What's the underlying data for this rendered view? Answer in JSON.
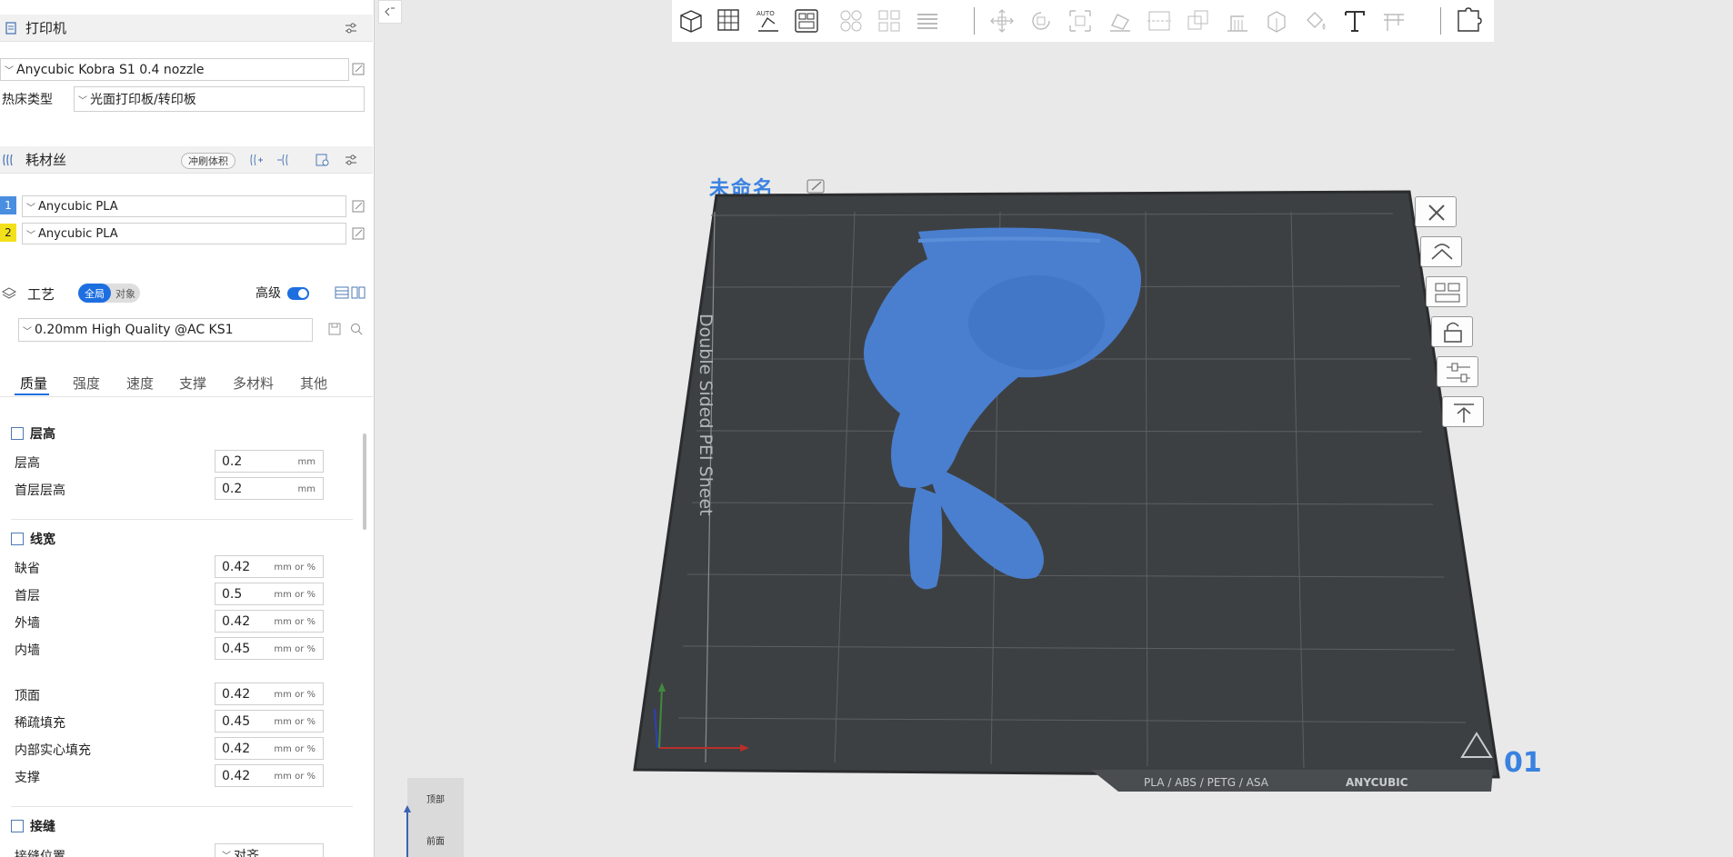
{
  "printer": {
    "header_title": "打印机",
    "printer_name": "Anycubic Kobra S1 0.4 nozzle",
    "bed_label": "热床类型",
    "bed_value": "光面打印板/转印板"
  },
  "filament": {
    "header_title": "耗材丝",
    "flush_button": "冲刷体积",
    "items": [
      {
        "index": "1",
        "color": "#4a8ee0",
        "name": "Anycubic PLA"
      },
      {
        "index": "2",
        "color": "#f2e11a",
        "name": "Anycubic PLA"
      }
    ]
  },
  "process": {
    "header_title": "工艺",
    "scope_global": "全局",
    "scope_object": "对象",
    "advanced_label": "高级",
    "preset": "0.20mm High Quality @AC KS1",
    "tabs": [
      "质量",
      "强度",
      "速度",
      "支撑",
      "多材料",
      "其他"
    ],
    "groups": {
      "layer_height": {
        "title": "层高",
        "params": [
          {
            "label": "层高",
            "value": "0.2",
            "unit": "mm"
          },
          {
            "label": "首层层高",
            "value": "0.2",
            "unit": "mm"
          }
        ]
      },
      "line_width": {
        "title": "线宽",
        "params": [
          {
            "label": "缺省",
            "value": "0.42",
            "unit": "mm or %"
          },
          {
            "label": "首层",
            "value": "0.5",
            "unit": "mm or %"
          },
          {
            "label": "外墙",
            "value": "0.42",
            "unit": "mm or %"
          },
          {
            "label": "内墙",
            "value": "0.45",
            "unit": "mm or %"
          },
          {
            "label": "顶面",
            "value": "0.42",
            "unit": "mm or %"
          },
          {
            "label": "稀疏填充",
            "value": "0.45",
            "unit": "mm or %"
          },
          {
            "label": "内部实心填充",
            "value": "0.42",
            "unit": "mm or %"
          },
          {
            "label": "支撑",
            "value": "0.42",
            "unit": "mm or %"
          }
        ]
      },
      "seam": {
        "title": "接缝",
        "params": [
          {
            "label": "接缝位置",
            "value": "对齐"
          }
        ]
      }
    }
  },
  "viewport": {
    "plate_name": "未命名",
    "plate_number": "01",
    "bed_side_text": "Double Sided PEI Sheet",
    "bed_material_text": "PLA / ABS / PETG / ASA",
    "bed_brand": "ANYCUBIC",
    "viewcube_top": "顶部",
    "viewcube_front": "前面"
  },
  "colors": {
    "accent": "#1d6fe0",
    "model": "#4a7fcf",
    "bed": "#3d4043",
    "plate_title": "#3a82e0"
  }
}
